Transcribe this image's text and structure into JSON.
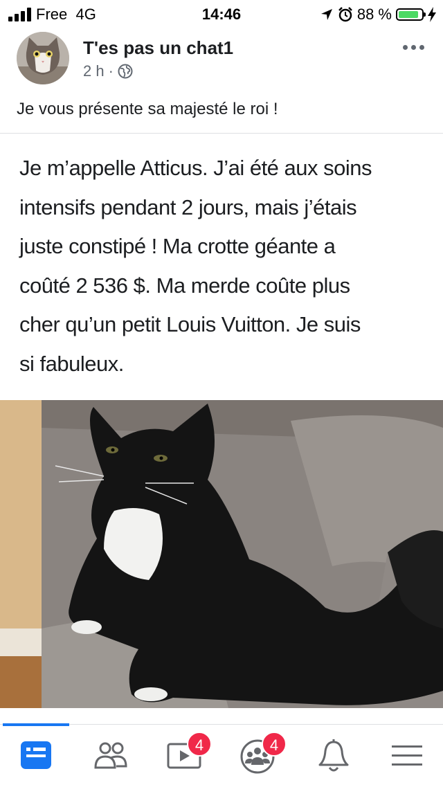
{
  "status_bar": {
    "carrier": "Free  4G",
    "time": "14:46",
    "battery_percent": "88 %",
    "battery_level": 0.88,
    "icons": [
      "signal-icon",
      "location-arrow-icon",
      "alarm-icon",
      "battery-icon",
      "charging-bolt-icon"
    ]
  },
  "post": {
    "author": "T'es pas un chat1",
    "time_ago": "2 h",
    "separator": "·",
    "audience_icon": "globe-icon",
    "caption": "Je vous présente sa majesté le roi !",
    "quote_lines": [
      "Je m’appelle Atticus. J’ai été aux soins",
      "intensifs pendant 2 jours, mais j’étais",
      "juste constipé ! Ma crotte géante a",
      "coûté 2 536 $. Ma merde coûte plus",
      "cher qu’un petit Louis Vuitton. Je suis",
      "si fabuleux."
    ]
  },
  "tabbar": {
    "tabs": [
      {
        "name": "news-feed",
        "icon": "news-feed-icon",
        "active": true
      },
      {
        "name": "friends",
        "icon": "friends-icon",
        "active": false
      },
      {
        "name": "watch",
        "icon": "watch-video-icon",
        "active": false,
        "badge": "4"
      },
      {
        "name": "groups",
        "icon": "groups-icon",
        "active": false,
        "badge": "4"
      },
      {
        "name": "notifications",
        "icon": "bell-icon",
        "active": false
      },
      {
        "name": "menu",
        "icon": "hamburger-menu-icon",
        "active": false
      }
    ]
  },
  "colors": {
    "accent": "#1877f2",
    "badge": "#f02849",
    "battery": "#4cd964"
  }
}
